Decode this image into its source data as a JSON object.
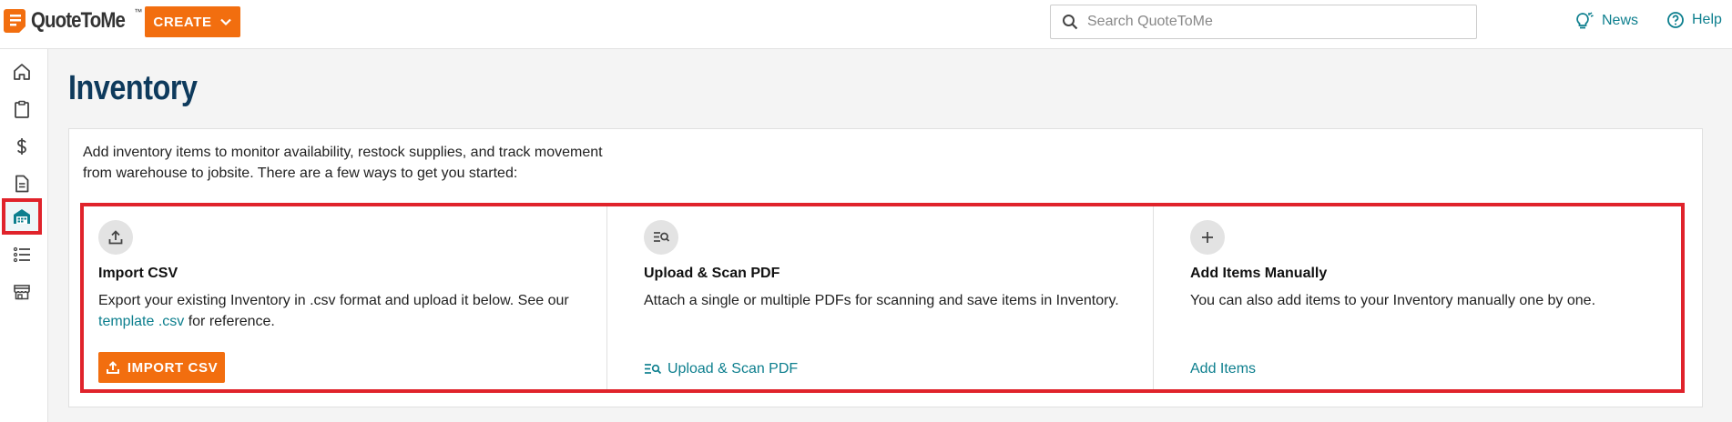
{
  "header": {
    "logo_text": "QuoteToMe",
    "logo_tm": "™",
    "create_label": "CREATE",
    "search_placeholder": "Search QuoteToMe",
    "news_label": "News",
    "help_label": "Help"
  },
  "sidebar": {
    "items": [
      {
        "name": "home-icon"
      },
      {
        "name": "clipboard-icon"
      },
      {
        "name": "dollar-icon"
      },
      {
        "name": "document-icon"
      },
      {
        "name": "warehouse-icon",
        "active": true
      },
      {
        "name": "list-icon"
      },
      {
        "name": "store-icon"
      }
    ]
  },
  "page": {
    "title": "Inventory",
    "intro": "Add inventory items to monitor availability, restock supplies, and track movement from warehouse to jobsite. There are a few ways to get you started:"
  },
  "cards": {
    "import": {
      "title": "Import CSV",
      "desc_before": "Export your existing Inventory in .csv format and upload it below. See our ",
      "desc_link": "template .csv",
      "desc_after": " for reference.",
      "button_label": "IMPORT CSV"
    },
    "scan": {
      "title": "Upload & Scan PDF",
      "desc": "Attach a single or multiple PDFs for scanning and save items in Inventory.",
      "link_label": "Upload & Scan PDF"
    },
    "manual": {
      "title": "Add Items Manually",
      "desc": "You can also add items to your Inventory manually one by one.",
      "link_label": "Add Items"
    }
  },
  "colors": {
    "accent_orange": "#f26e0f",
    "link_teal": "#0d7f8e",
    "title_navy": "#0e3a5c",
    "highlight_red": "#e0232b"
  }
}
